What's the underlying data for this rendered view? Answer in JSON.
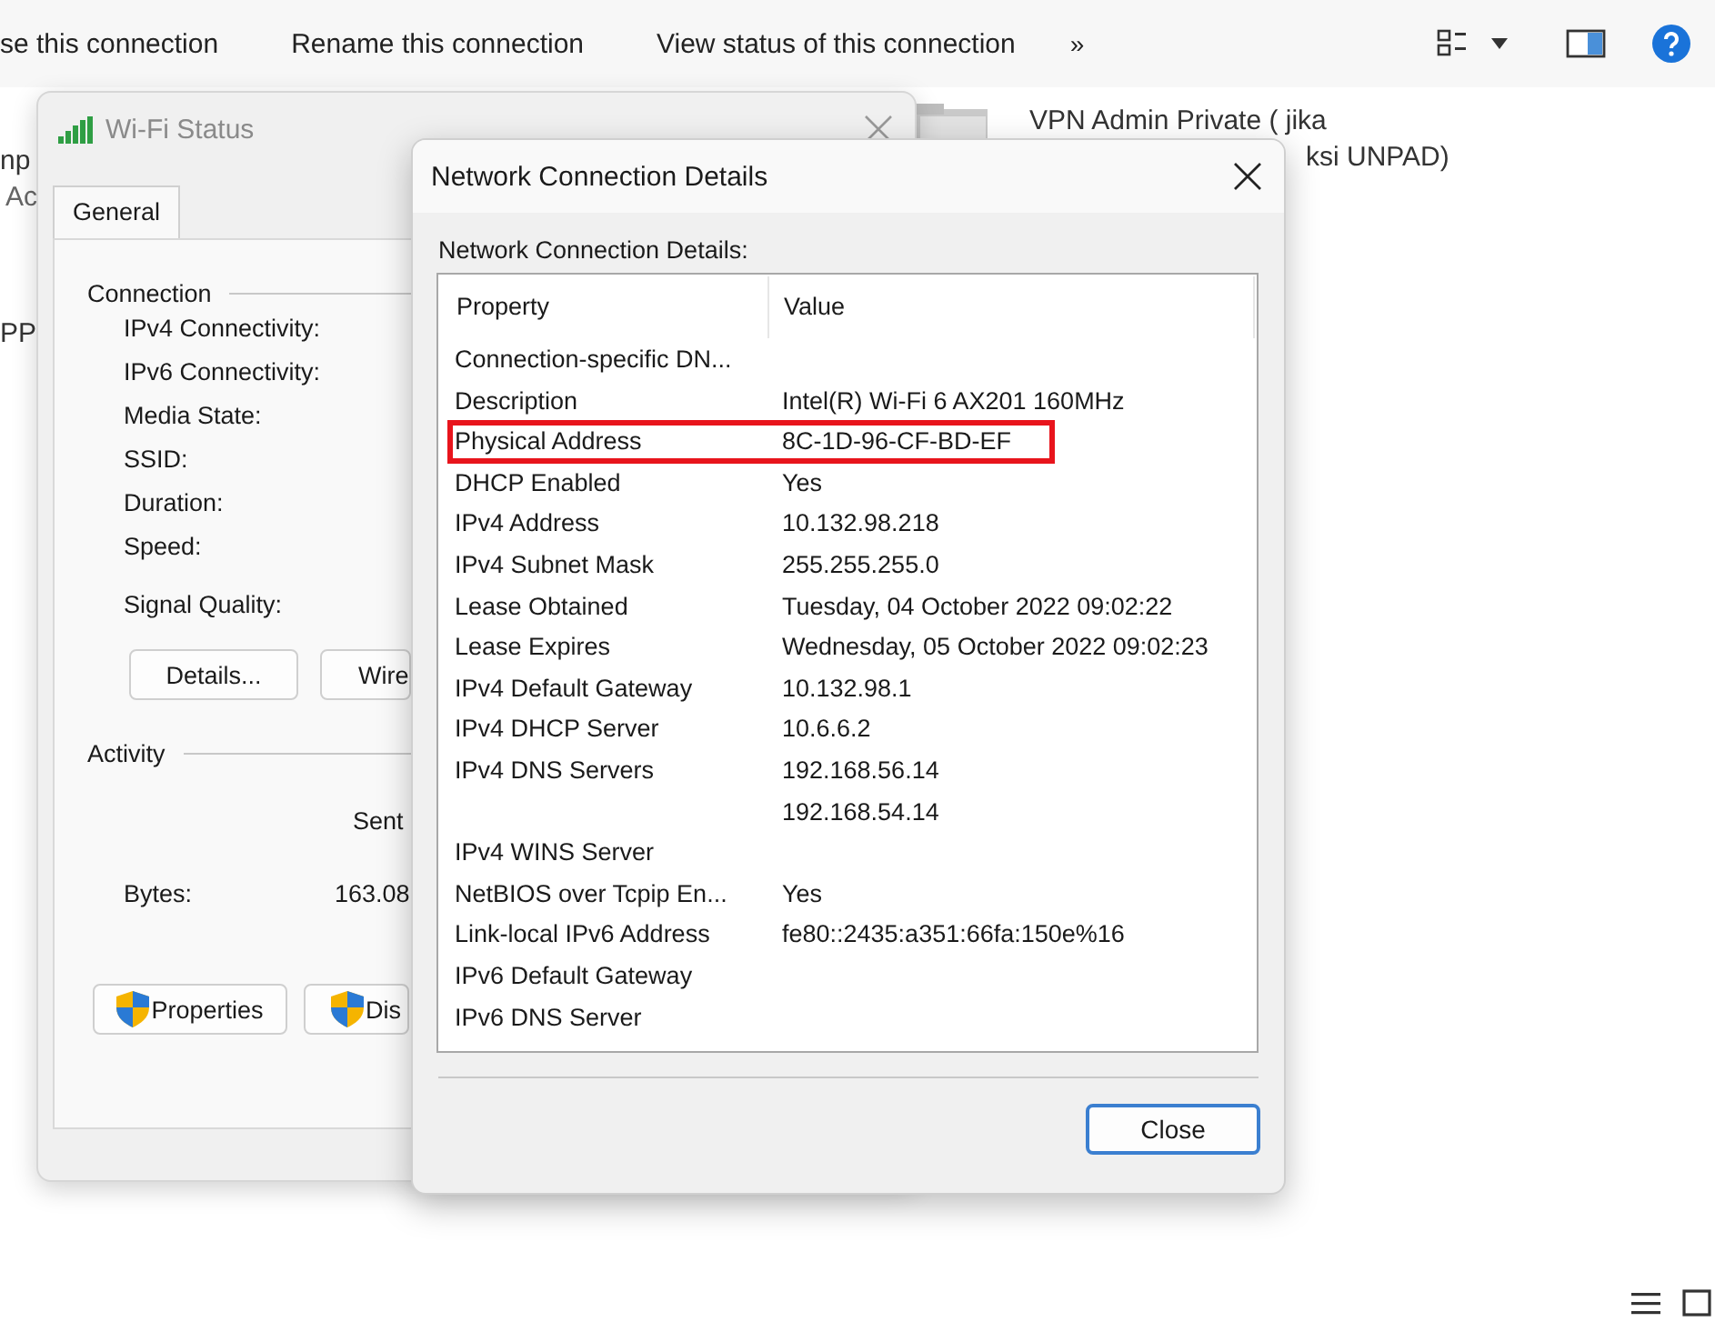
{
  "toolbar": {
    "commands": [
      "se this connection",
      "Rename this connection",
      "View status of this connection"
    ],
    "more": "»"
  },
  "background_fragments": [
    "np",
    "Ac",
    "PP"
  ],
  "vpn_item": {
    "name_lines": [
      "VPN Admin Private ( jika",
      "ksi UNPAD)"
    ]
  },
  "wifi_status": {
    "title": "Wi-Fi Status",
    "tabs": [
      {
        "label": "General",
        "selected": true
      }
    ],
    "connection": {
      "heading": "Connection",
      "labels": [
        "IPv4 Connectivity:",
        "IPv6 Connectivity:",
        "Media State:",
        "SSID:",
        "Duration:",
        "Speed:"
      ],
      "signal_label": "Signal Quality:"
    },
    "buttons": [
      "Details...",
      "Wire"
    ],
    "activity": {
      "heading": "Activity",
      "sent": "Sent",
      "bytes_label": "Bytes:",
      "bytes_sent": "163.08"
    },
    "bottom_buttons": [
      "Properties",
      "Dis"
    ]
  },
  "details_dialog": {
    "title": "Network Connection Details",
    "caption": "Network Connection Details:",
    "columns": [
      "Property",
      "Value"
    ],
    "rows": [
      {
        "property": "Connection-specific DN...",
        "highlighted": false
      },
      {
        "property": "Description",
        "value": "Intel(R) Wi-Fi 6 AX201 160MHz",
        "highlighted": false
      },
      {
        "property": "Physical Address",
        "value": "8C-1D-96-CF-BD-EF",
        "highlighted": true
      },
      {
        "property": "DHCP Enabled",
        "value": "Yes",
        "highlighted": false
      },
      {
        "property": "IPv4 Address",
        "value": "10.132.98.218",
        "highlighted": false
      },
      {
        "property": "IPv4 Subnet Mask",
        "value": "255.255.255.0",
        "highlighted": false
      },
      {
        "property": "Lease Obtained",
        "value": "Tuesday, 04 October 2022 09:02:22",
        "highlighted": false
      },
      {
        "property": "Lease Expires",
        "value": "Wednesday, 05 October 2022 09:02:23",
        "highlighted": false
      },
      {
        "property": "IPv4 Default Gateway",
        "value": "10.132.98.1",
        "highlighted": false
      },
      {
        "property": "IPv4 DHCP Server",
        "value": "10.6.6.2",
        "highlighted": false
      },
      {
        "property": "IPv4 DNS Servers",
        "value": "192.168.56.14",
        "highlighted": false
      },
      {
        "value": "192.168.54.14",
        "highlighted": false
      },
      {
        "property": "IPv4 WINS Server",
        "highlighted": false
      },
      {
        "property": "NetBIOS over Tcpip En...",
        "value": "Yes",
        "highlighted": false
      },
      {
        "property": "Link-local IPv6 Address",
        "value": "fe80::2435:a351:66fa:150e%16",
        "highlighted": false
      },
      {
        "property": "IPv6 Default Gateway",
        "highlighted": false
      },
      {
        "property": "IPv6 DNS Server",
        "highlighted": false
      }
    ],
    "close_button": "Close"
  }
}
